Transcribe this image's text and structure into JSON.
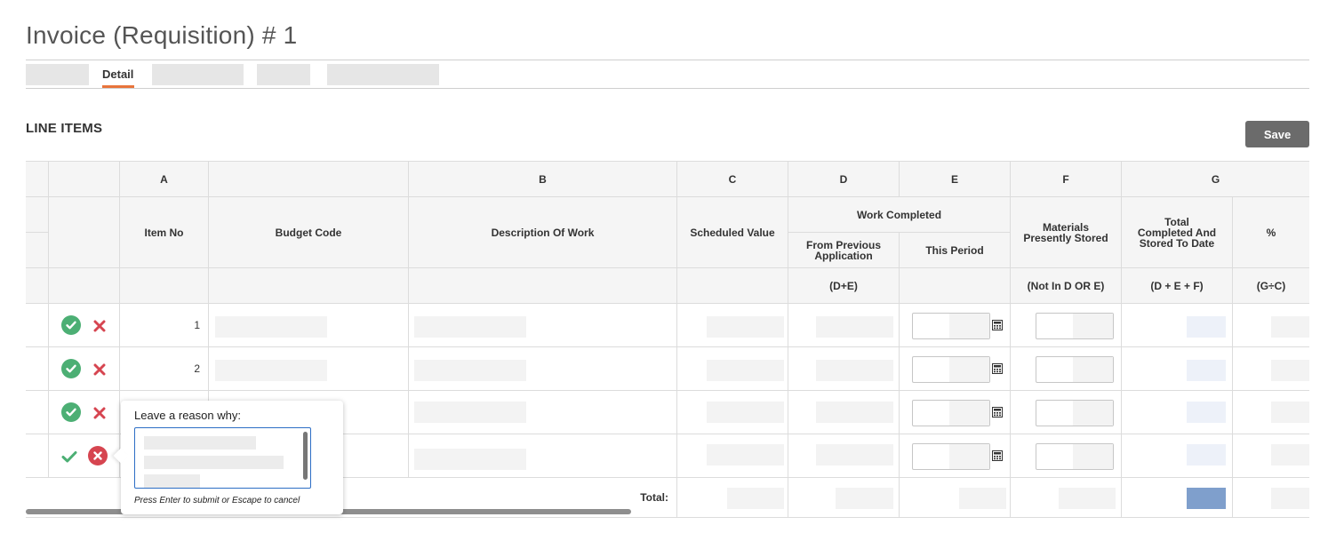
{
  "page": {
    "title": "Invoice (Requisition) # 1"
  },
  "tabs": {
    "active": "Detail"
  },
  "section": {
    "title": "LINE ITEMS",
    "save_label": "Save"
  },
  "table": {
    "letters": {
      "A": "A",
      "B": "B",
      "C": "C",
      "D": "D",
      "E": "E",
      "F": "F",
      "G": "G"
    },
    "headers": {
      "item_no": "Item No",
      "budget_code": "Budget Code",
      "description": "Description Of Work",
      "scheduled_value": "Scheduled Value",
      "work_completed": "Work Completed",
      "from_previous": "From Previous Application",
      "this_period": "This Period",
      "materials": "Materials Presently Stored",
      "total_completed": "Total Completed And Stored To Date",
      "percent": "%"
    },
    "formulas": {
      "d": "(D+E)",
      "f": "(Not In D OR E)",
      "g": "(D + E + F)",
      "pct": "(G÷C)"
    },
    "rows": [
      {
        "item_no": "1"
      },
      {
        "item_no": "2"
      },
      {
        "item_no": ""
      },
      {
        "item_no": ""
      }
    ],
    "total_label": "Total:"
  },
  "popover": {
    "label": "Leave a reason why:",
    "hint": "Press Enter to submit or Escape to cancel"
  },
  "colors": {
    "accent_tab": "#e8743b",
    "approve_green": "#4caf74",
    "reject_red": "#d64550",
    "save_button": "#6b6b6b",
    "focus_blue": "#2d6ec5"
  },
  "icons": [
    "check-circle-icon",
    "x-icon",
    "x-circle-icon",
    "check-icon",
    "calculator-icon"
  ]
}
